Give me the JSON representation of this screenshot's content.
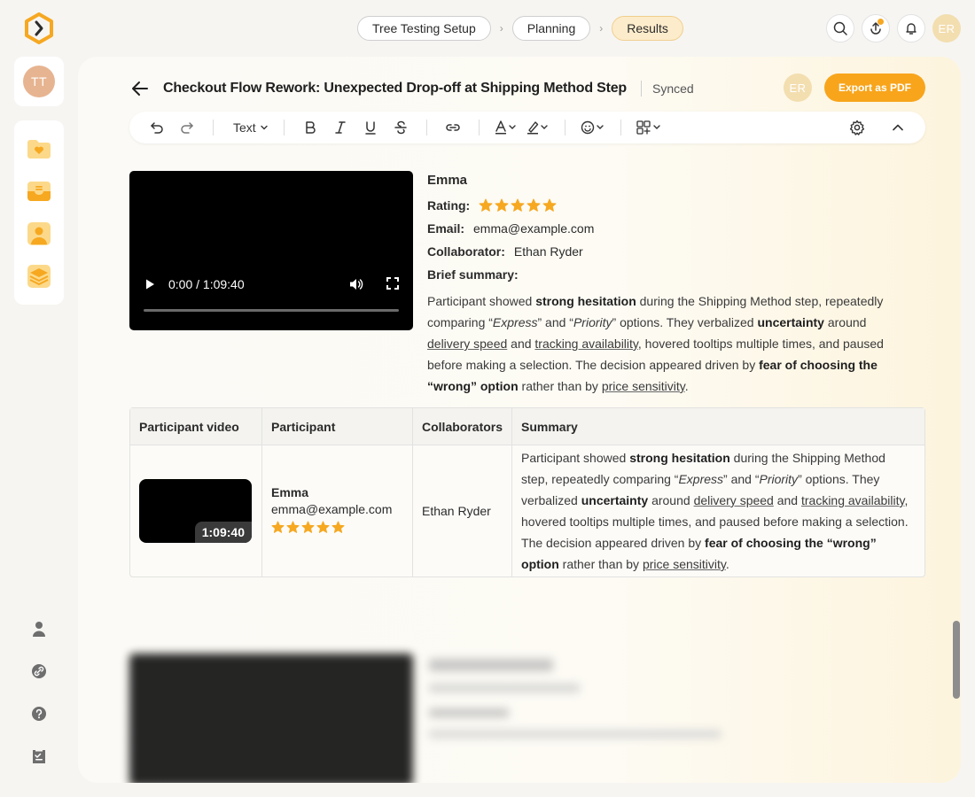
{
  "breadcrumbs": [
    "Tree Testing Setup",
    "Planning",
    "Results"
  ],
  "user_initials": "ER",
  "sidebar": {
    "user_initials": "TT"
  },
  "doc": {
    "title": "Checkout Flow Rework: Unexpected Drop-off at Shipping Method Step",
    "status": "Synced",
    "collaborator_initials": "ER",
    "export_label": "Export as PDF"
  },
  "toolbar": {
    "text_style": "Text"
  },
  "participant": {
    "name": "Emma",
    "rating_label": "Rating:",
    "rating": 5,
    "email_label": "Email:",
    "email": "emma@example.com",
    "collaborator_label": "Collaborator:",
    "collaborator": "Ethan Ryder",
    "summary_label": "Brief summary:",
    "video_time": "0:00 / 1:09:40",
    "duration": "1:09:40",
    "summary": {
      "s1": "Participant showed ",
      "b1": "strong hesitation",
      "s2": " during the Shipping Method step, repeatedly comparing “",
      "i1": "Express",
      "s3": "” and “",
      "i2": "Priority",
      "s4": "” options. They verbalized ",
      "b2": "uncertainty",
      "s5": " around ",
      "u1": "delivery speed",
      "s6": " and ",
      "u2": "tracking availability",
      "s7": ", hovered tooltips multiple times, and paused before making a selection. The decision appeared driven by ",
      "b3": "fear of choosing the “wrong” option",
      "s8": " rather than by ",
      "u3": "price sensitivity",
      "s9": "."
    }
  },
  "table": {
    "headers": [
      "Participant video",
      "Participant",
      "Collaborators",
      "Summary"
    ]
  },
  "colors": {
    "accent": "#f8a51c",
    "star": "#f6a821",
    "active_crumb": "#fdeccb"
  }
}
